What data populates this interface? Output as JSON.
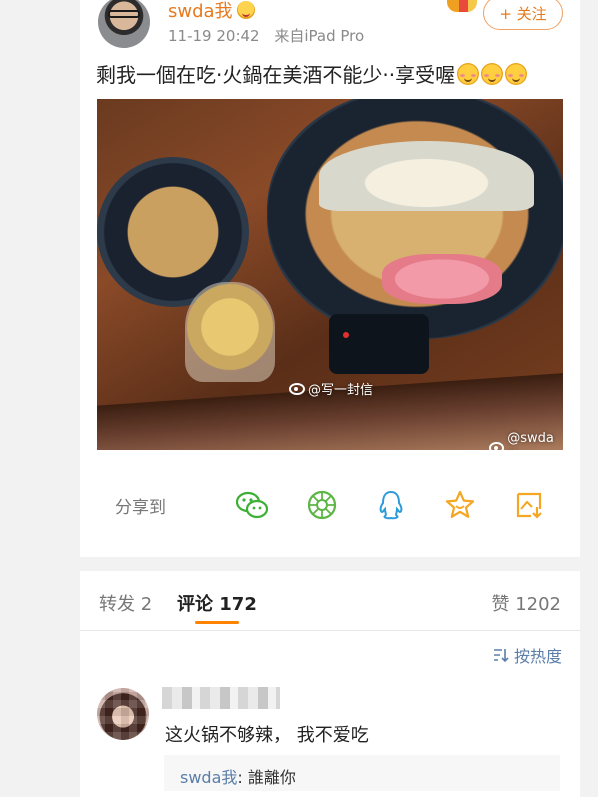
{
  "post": {
    "username": "swda我",
    "time": "11-19 20:42",
    "source": "来自iPad Pro",
    "follow_label": "+ 关注",
    "text": "剩我一個在吃·火鍋在美酒不能少··享受喔",
    "emoji_count": 3,
    "image": {
      "watermark_1": "@写一封信",
      "watermark_2": "@swda我"
    }
  },
  "share": {
    "label": "分享到",
    "targets": [
      "wechat-icon",
      "moments-icon",
      "qq-icon",
      "favorite-star-icon",
      "save-image-icon"
    ]
  },
  "comments_section": {
    "tabs": {
      "repost": "转发 2",
      "comments": "评论 172",
      "likes": "赞 1202"
    },
    "sort_label": "按热度",
    "comment": {
      "text": "这火锅不够辣， 我不爱吃",
      "reply_author": "swda我",
      "reply_sep": ":",
      "reply_text": " 誰離你"
    }
  },
  "colors": {
    "accent": "#ff8200",
    "username": "#e67a1d",
    "link": "#5a7ea8",
    "wechat": "#3cb034",
    "qq": "#2d9cdb",
    "star": "#f5a623"
  }
}
